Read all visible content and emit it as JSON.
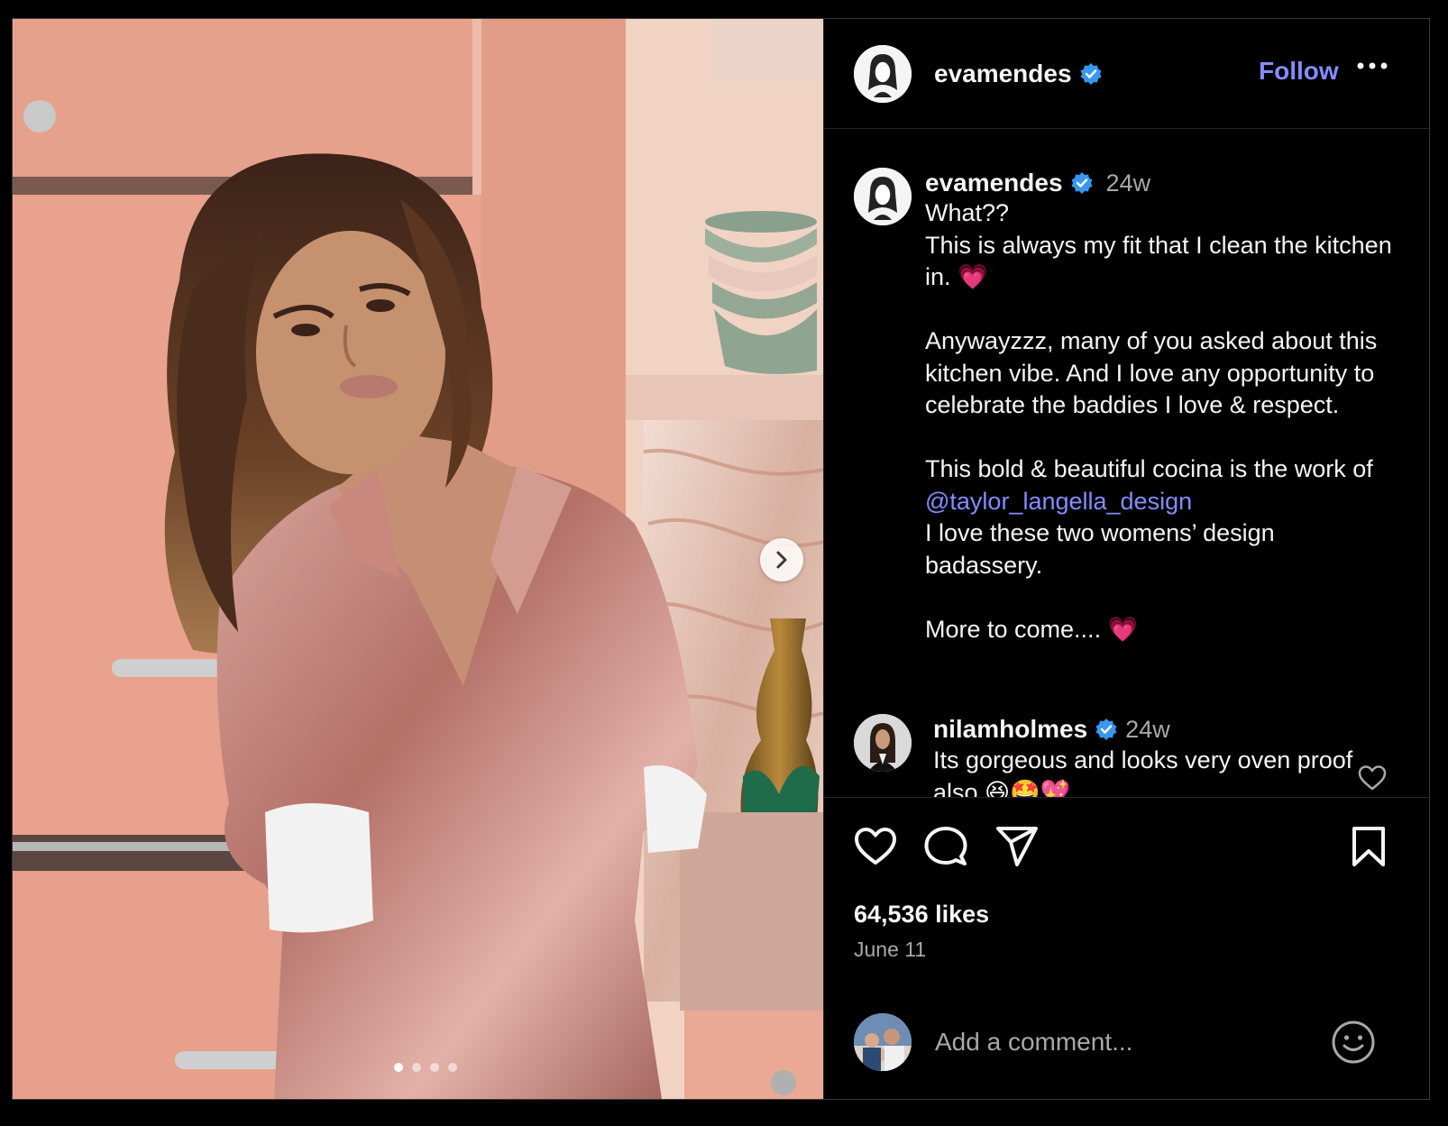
{
  "colors": {
    "background": "#000000",
    "text": "#f5f5f5",
    "muted": "#a8a8a8",
    "link": "#858cff",
    "verified": "#3897f0",
    "divider": "#262626"
  },
  "media": {
    "carousel_dot_count": 4,
    "active_dot_index": 0,
    "next_icon": "chevron-right-icon"
  },
  "header": {
    "username": "evamendes",
    "verified_icon": "verified-badge-icon",
    "follow_label": "Follow",
    "more_icon": "more-horizontal-icon"
  },
  "caption": {
    "username": "evamendes",
    "time": "24w",
    "body_before_mention": "What??\nThis is always my fit that I clean the kitchen in. 💗\n\nAnywayzzz, many of you asked about this kitchen vibe. And I love any opportunity to celebrate the baddies I love & respect.\n\nThis bold & beautiful cocina is the work of ",
    "mention": "@taylor_langella_design",
    "body_after_mention": "\nI love these two womens’ design badassery.\n\nMore to come.... 💗"
  },
  "comment": {
    "username": "nilamholmes",
    "time": "24w",
    "body": "Its gorgeous and looks very oven proof also 😆🤩💖",
    "like_icon": "heart-icon"
  },
  "actions": {
    "like_icon": "heart-icon",
    "comment_icon": "comment-bubble-icon",
    "share_icon": "send-icon",
    "save_icon": "bookmark-icon"
  },
  "likes": "64,536 likes",
  "date": "June 11",
  "add_comment": {
    "placeholder": "Add a comment...",
    "emoji_icon": "emoji-icon"
  }
}
